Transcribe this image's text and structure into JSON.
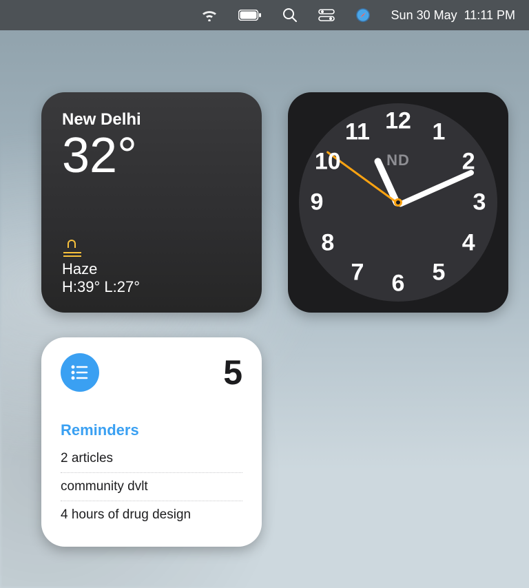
{
  "menubar": {
    "date": "Sun 30 May",
    "time": "11:11 PM"
  },
  "weather": {
    "location": "New Delhi",
    "temperature": "32°",
    "condition": "Haze",
    "high_low": "H:39° L:27°"
  },
  "clock": {
    "timezone": "ND",
    "hour": 11,
    "minute": 11,
    "second": 51
  },
  "reminders": {
    "count": "5",
    "title": "Reminders",
    "items": [
      "2 articles",
      "community dvlt",
      "4 hours of drug design"
    ]
  }
}
